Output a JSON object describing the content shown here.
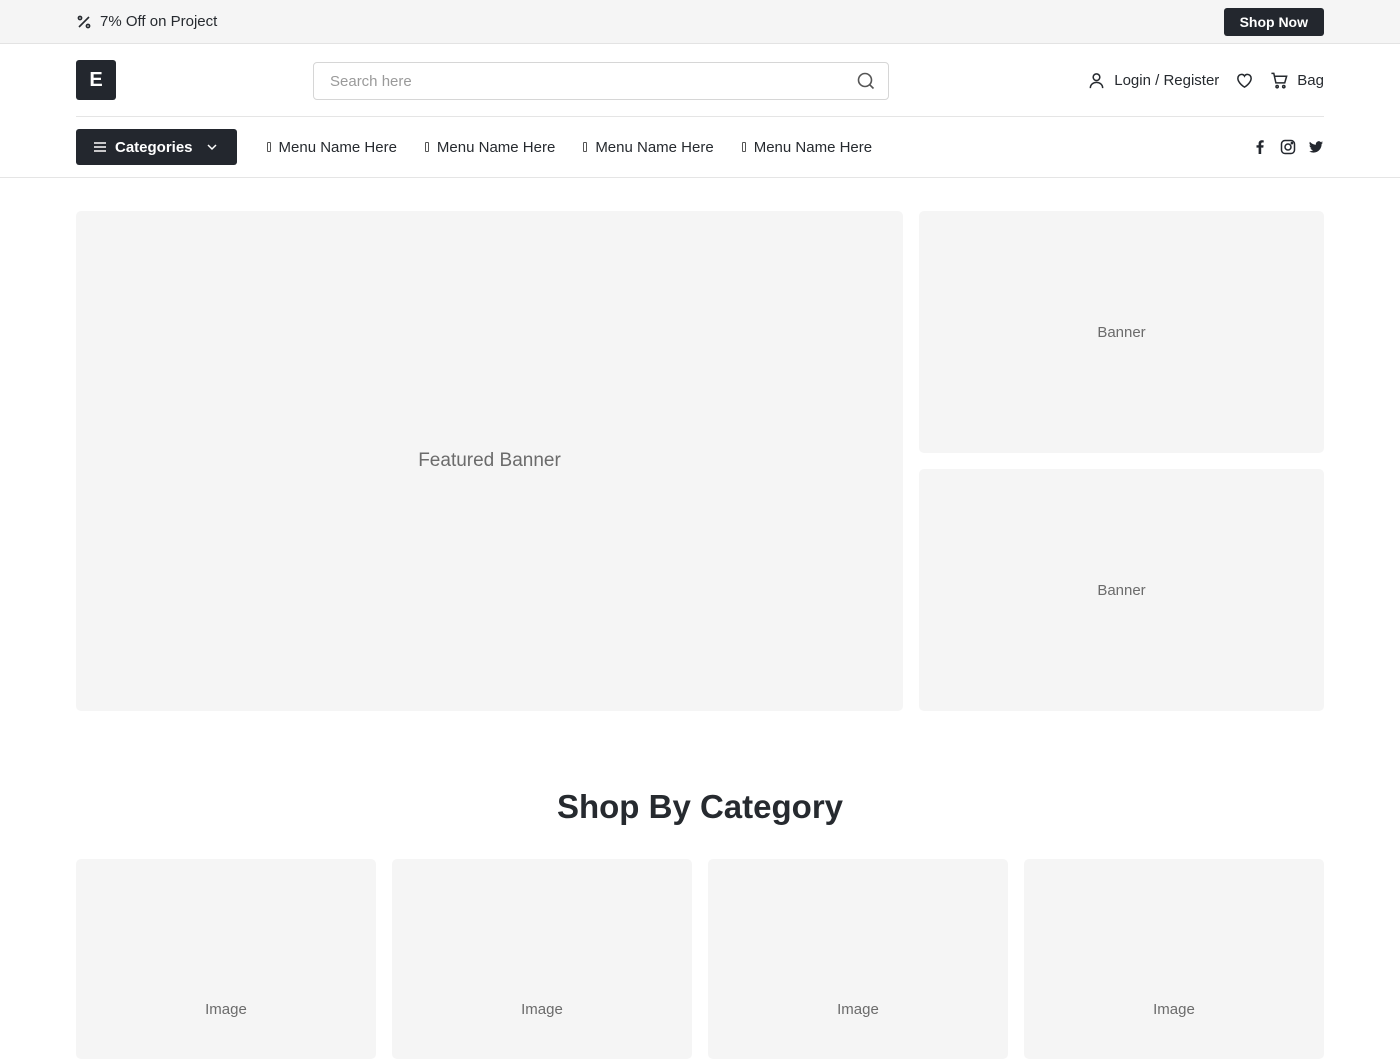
{
  "promo": {
    "text": "7% Off on Project",
    "button_label": "Shop Now"
  },
  "header": {
    "logo_text": "E",
    "search_placeholder": "Search here",
    "search_value": "",
    "login_label": "Login / Register",
    "bag_label": "Bag"
  },
  "nav": {
    "categories_label": "Categories",
    "menu": [
      {
        "label": "Menu Name Here"
      },
      {
        "label": "Menu Name Here"
      },
      {
        "label": "Menu Name Here"
      },
      {
        "label": "Menu Name Here"
      }
    ],
    "socials": [
      "facebook-icon",
      "instagram-icon",
      "twitter-icon"
    ]
  },
  "hero": {
    "featured_label": "Featured Banner",
    "side_banners": [
      {
        "label": "Banner"
      },
      {
        "label": "Banner"
      }
    ]
  },
  "category_section": {
    "title": "Shop By Category",
    "cards": [
      {
        "label": "Image"
      },
      {
        "label": "Image"
      },
      {
        "label": "Image"
      },
      {
        "label": "Image"
      }
    ]
  },
  "colors": {
    "dark": "#23272e",
    "placeholder_bg": "#f5f5f5",
    "border": "#e5e5e5"
  }
}
